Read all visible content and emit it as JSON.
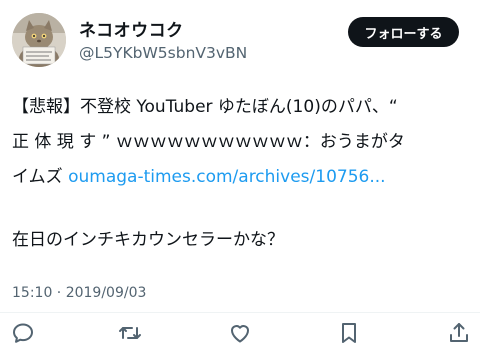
{
  "tweet": {
    "author_name": "ネコオウコク",
    "handle": "@L5YKbW5sbnV3vBN",
    "follow_label": "フォローする",
    "quote_line1": "【悲報】不登校 YouTuber ゆたぼん(10)のパパ、“",
    "quote_line2": "正 体 現 す ” ｗｗｗｗｗｗｗｗｗｗｗ：おうまがタ",
    "quote_line3": "イムズ ",
    "link_text": "oumaga-times.com/archives/10756...",
    "comment": "在日のインチキカウンセラーかな？",
    "timestamp": "15:10 · 2019/09/03"
  },
  "actions": {
    "reply_icon": "reply-icon",
    "retweet_icon": "retweet-icon",
    "like_icon": "heart-icon",
    "bookmark_icon": "bookmark-icon",
    "share_icon": "share-icon"
  },
  "colors": {
    "link": "#1d9bf0",
    "follow_bg": "#0f1419",
    "muted_text": "#536471",
    "icon": "#536471"
  }
}
